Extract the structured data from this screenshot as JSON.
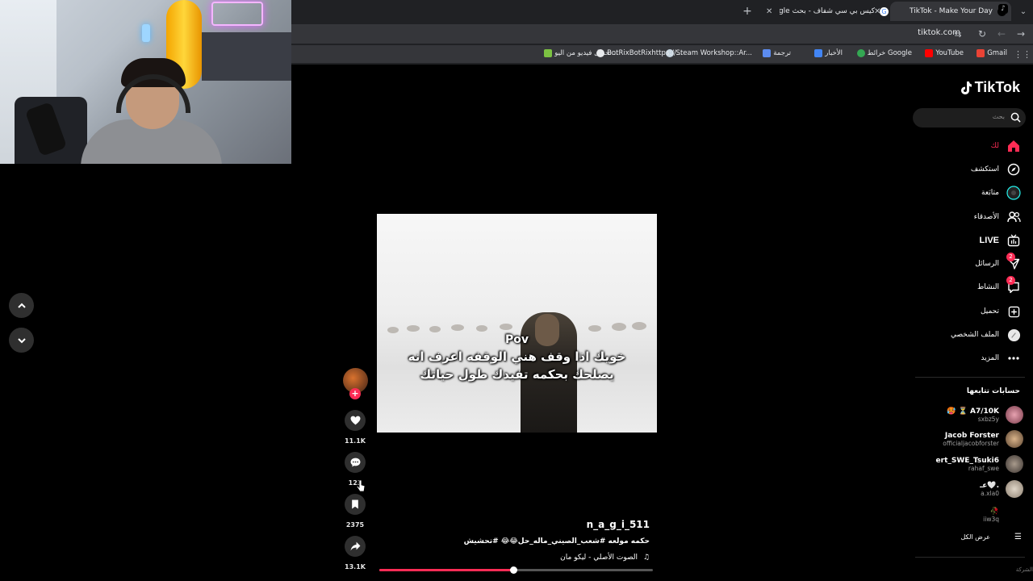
{
  "browser": {
    "tabs": [
      {
        "title": "TikTok - Make Your Day",
        "active": true
      },
      {
        "title": "كيس بي سي شفاف - بحث Google",
        "active": false
      }
    ],
    "url": "tiktok.com",
    "bookmarks": [
      {
        "label": "Gmail",
        "icon": "gmail-icon"
      },
      {
        "label": "YouTube",
        "icon": "youtube-icon"
      },
      {
        "label": "خرائط Google",
        "icon": "maps-icon"
      },
      {
        "label": "الأخبار",
        "icon": "news-icon"
      },
      {
        "label": "ترجمة",
        "icon": "translate-icon"
      },
      {
        "label": "Steam Workshop::Ar...",
        "icon": "steam-icon"
      },
      {
        "label": "BotRixBotRixhttps://...",
        "icon": "download-icon"
      },
      {
        "label": "تحميل فيديو من اليو...",
        "icon": "download-icon"
      }
    ]
  },
  "video": {
    "overlay_line1": "Pov",
    "overlay_line2": "خويك اذا وقف هني الوقفه اعرف انه",
    "overlay_line3": "يصلحك بحكمه تفيدك طول حياتك",
    "progress": 0.49
  },
  "actions": {
    "likes": "11.1K",
    "comments": "123",
    "saves": "2375",
    "shares": "13.1K"
  },
  "post": {
    "author": "n_a_g_i_511",
    "description": "حكمه مولعه #شعب_الصيني_ماله_حل😂😂 #تحشيش",
    "music": "الصوت الأصلي - ليكو مان"
  },
  "sidebar": {
    "logo": "TikTok",
    "search_placeholder": "بحث",
    "items": [
      {
        "label": "لك",
        "icon": "home-icon"
      },
      {
        "label": "استكشف",
        "icon": "compass-icon"
      },
      {
        "label": "متابَعة",
        "icon": "following-icon"
      },
      {
        "label": "الأصدقاء",
        "icon": "friends-icon"
      },
      {
        "label": "LIVE",
        "icon": "live-icon"
      },
      {
        "label": "الرسائل",
        "icon": "messages-icon",
        "badge": "2"
      },
      {
        "label": "النشاط",
        "icon": "activity-icon",
        "badge": "2"
      },
      {
        "label": "تحميل",
        "icon": "upload-icon"
      },
      {
        "label": "الملف الشخصي",
        "icon": "profile-icon"
      },
      {
        "label": "المزيد",
        "icon": "more-icon"
      }
    ],
    "following_title": "حسابات تتابعها",
    "following": [
      {
        "name": "🥵 ⏳ A7/10K",
        "handle": "sxbz5y"
      },
      {
        "name": "Jacob Forster",
        "handle": "officialjacobforster"
      },
      {
        "name": "ert_SWE_Tsuki6",
        "handle": "rahaf_swe"
      },
      {
        "name": "عـ🤍.",
        "handle": "a.xla0"
      },
      {
        "name": "🥀",
        "handle": "iiw3q"
      }
    ],
    "see_all": "عرض الكل",
    "footer_cut": "الشركة"
  }
}
